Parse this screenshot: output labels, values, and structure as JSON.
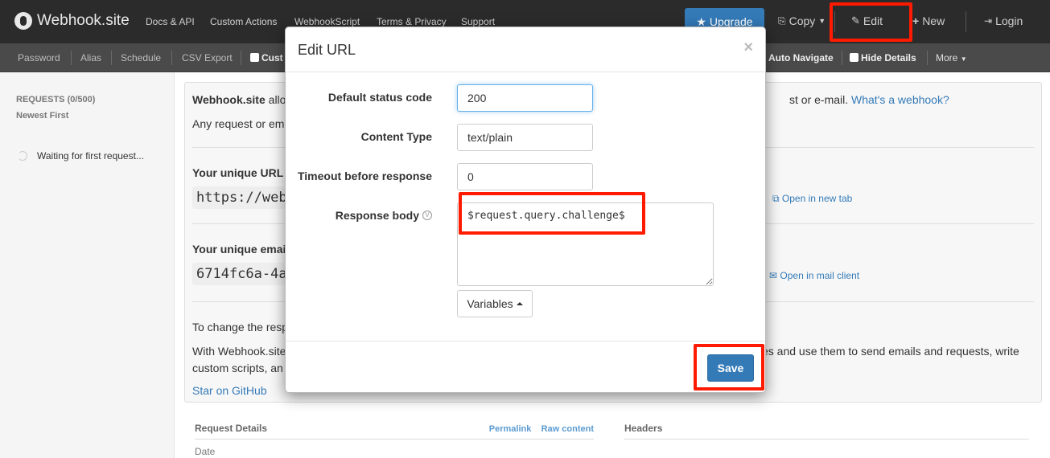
{
  "navbar": {
    "brand": "Webhook.site",
    "links": [
      "Docs & API",
      "Custom Actions",
      "WebhookScript",
      "Terms & Privacy",
      "Support"
    ],
    "upgrade": "Upgrade",
    "copy": "Copy",
    "edit": "Edit",
    "new": "New",
    "login": "Login"
  },
  "toolbar": {
    "password": "Password",
    "alias": "Alias",
    "schedule": "Schedule",
    "csv_export": "CSV Export",
    "cust_truncated": "Cust",
    "auto_navigate": "Auto Navigate",
    "hide_details": "Hide Details",
    "more": "More"
  },
  "sidebar": {
    "requests_title": "REQUESTS (0/500)",
    "sort": "Newest First",
    "waiting": "Waiting for first request..."
  },
  "panel": {
    "intro_bold": "Webhook.site",
    "intro_rest": " allo",
    "intro_right": "st or e-mail.",
    "whats_webhook": "What's a webhook?",
    "any_request": "Any request or em",
    "unique_url_label": "Your unique URL",
    "unique_url_value": "https://web",
    "open_new_tab": "Open in new tab",
    "unique_email_label": "Your unique emai",
    "unique_email_value": "6714fc6a-4a",
    "open_mail_client": "Open in mail client",
    "change_resp": "To change the resp",
    "with_webhook": "With Webhook.site",
    "with_webhook_right": "es and use them to send emails and requests, write",
    "custom_scripts": "custom scripts, an",
    "star_github": "Star on GitHub"
  },
  "lower": {
    "request_details": "Request Details",
    "permalink": "Permalink",
    "raw_content": "Raw content",
    "headers": "Headers",
    "date": "Date"
  },
  "modal": {
    "title": "Edit URL",
    "close": "×",
    "fields": {
      "status_label": "Default status code",
      "status_value": "200",
      "content_type_label": "Content Type",
      "content_type_value": "text/plain",
      "timeout_label": "Timeout before response",
      "timeout_value": "0",
      "body_label": "Response body",
      "body_value": "$request.query.challenge$"
    },
    "variables": "Variables",
    "save": "Save"
  },
  "colors": {
    "navbar_bg": "#2b2b2b",
    "accent": "#337ab7",
    "annotation": "#ff1a00"
  }
}
